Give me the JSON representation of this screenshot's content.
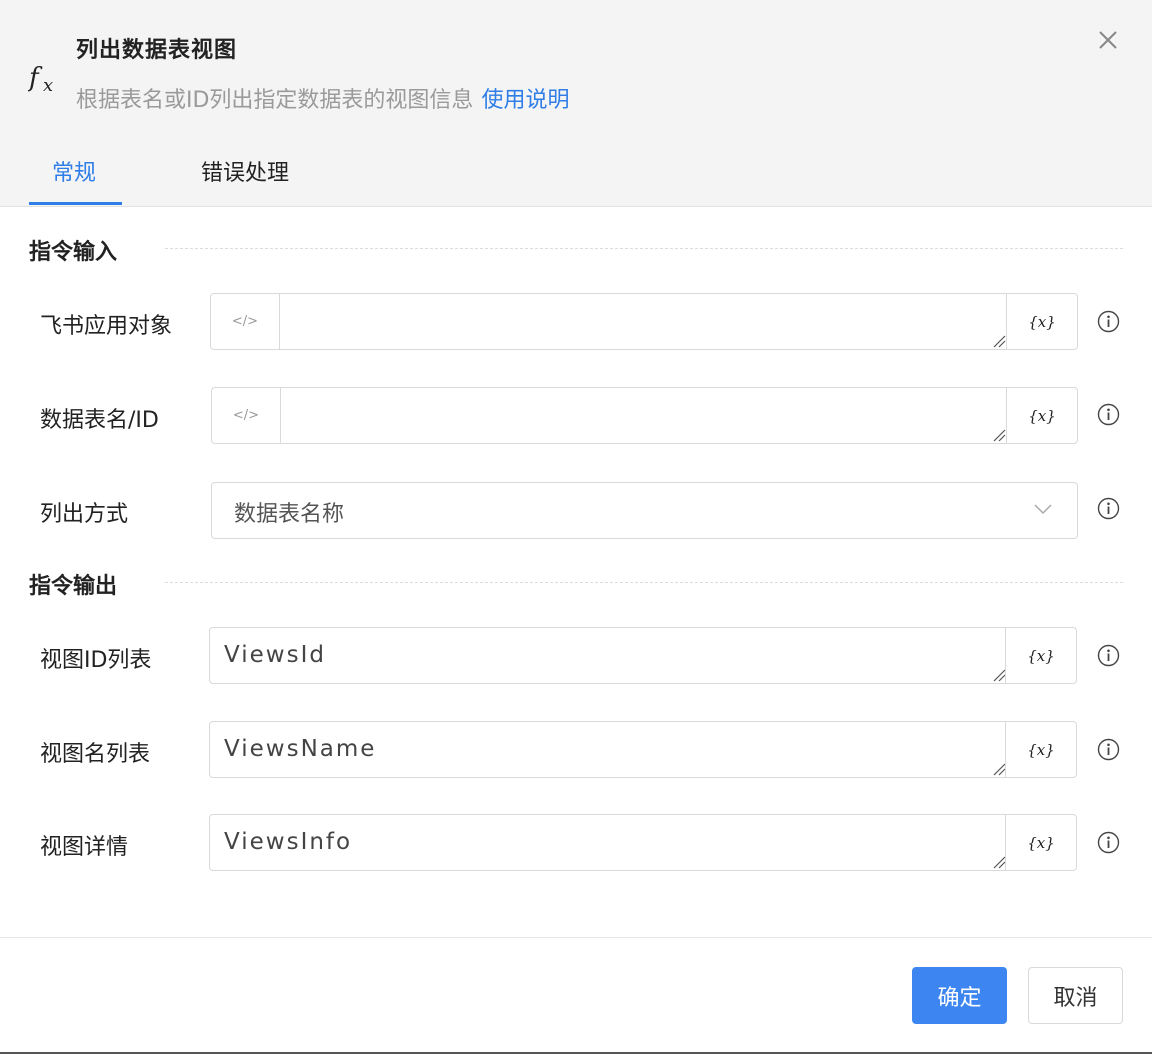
{
  "dialog": {
    "title": "列出数据表视图",
    "subtitle": "根据表名或ID列出指定数据表的视图信息",
    "help_link": "使用说明",
    "icon": "fx-icon",
    "close_icon": "close-icon"
  },
  "tabs": [
    {
      "label": "常规",
      "active": true
    },
    {
      "label": "错误处理",
      "active": false
    }
  ],
  "sections": {
    "input_title": "指令输入",
    "output_title": "指令输出"
  },
  "fields": {
    "feishu_app": {
      "label": "飞书应用对象",
      "value": ""
    },
    "table_name_id": {
      "label": "数据表名/ID",
      "value": ""
    },
    "list_mode": {
      "label": "列出方式",
      "value": "数据表名称"
    },
    "view_id_list": {
      "label": "视图ID列表",
      "value": "ViewsId"
    },
    "view_name_list": {
      "label": "视图名列表",
      "value": "ViewsName"
    },
    "view_detail": {
      "label": "视图详情",
      "value": "ViewsInfo"
    }
  },
  "var_button_label": "{x}",
  "code_icon_label": "</>",
  "footer": {
    "ok_label": "确定",
    "cancel_label": "取消"
  },
  "colors": {
    "accent": "#2f7de6",
    "primary_button": "#3d86f1",
    "header_bg": "#f4f4f5"
  }
}
